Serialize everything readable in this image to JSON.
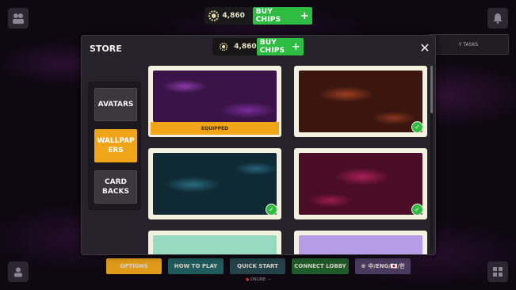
{
  "chips": {
    "amount": "4,860",
    "buy_label": "BUY CHIPS"
  },
  "tasks_text": "Y TASKS",
  "bottom_nav": {
    "options": "OPTIONS",
    "how_to_play": "HOW TO PLAY",
    "quick_start": "QUICK START",
    "connect_lobby": "CONNECT LOBBY",
    "language": "中/ENG/🇯🇵/한"
  },
  "online_text": "ONLINE: --",
  "store": {
    "title": "STORE",
    "close": "✕",
    "categories": [
      {
        "label": "AVATARS",
        "active": false
      },
      {
        "label": "WALLPAP ERS",
        "active": true
      },
      {
        "label": "CARD BACKS",
        "active": false
      }
    ],
    "wallpapers": [
      {
        "color": "#5a1e6e",
        "status": "EQUIPPED"
      },
      {
        "color": "#5c2416",
        "status": "owned"
      },
      {
        "color": "#16404e",
        "status": "owned"
      },
      {
        "color": "#6e1238",
        "status": "owned"
      },
      {
        "color": "#98d9c2",
        "status": ""
      },
      {
        "color": "#b59ee6",
        "status": ""
      }
    ]
  },
  "colors": {
    "accent_orange": "#f0a518",
    "buy_green": "#2ebd42",
    "modal_bg": "#262229",
    "card_frame": "#f4f0e0"
  }
}
